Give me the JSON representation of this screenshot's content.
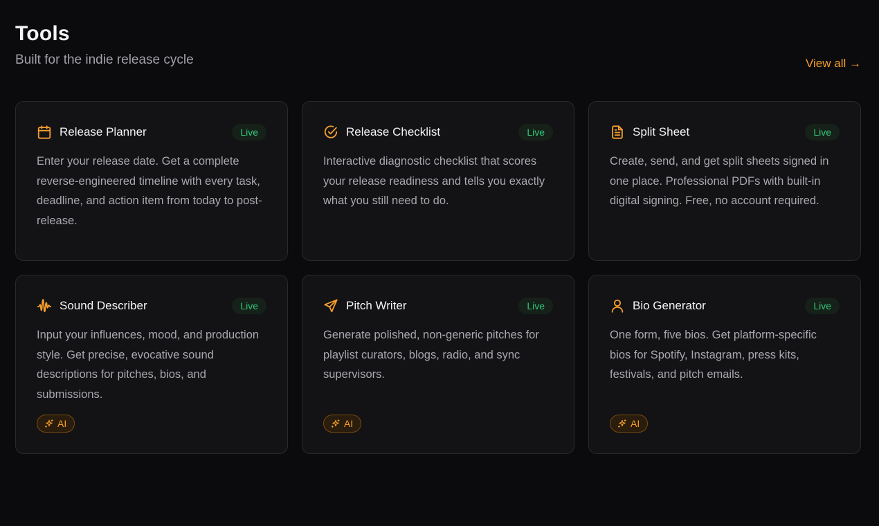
{
  "header": {
    "title": "Tools",
    "subtitle": "Built for the indie release cycle",
    "view_all": "View all →"
  },
  "colors": {
    "accent": "#f59e2c",
    "live": "#34c77b",
    "background": "#0b0b0d",
    "card": "#131315"
  },
  "cards": [
    {
      "title": "Release Planner",
      "icon": "calendar-icon",
      "status": "Live",
      "description": "Enter your release date. Get a complete reverse-engineered timeline with every task, deadline, and action item from today to post-release."
    },
    {
      "title": "Release Checklist",
      "icon": "check-circle-icon",
      "status": "Live",
      "description": "Interactive diagnostic checklist that scores your release readiness and tells you exactly what you still need to do."
    },
    {
      "title": "Split Sheet",
      "icon": "document-icon",
      "status": "Live",
      "description": "Create, send, and get split sheets signed in one place. Professional PDFs with built-in digital signing. Free, no account required."
    },
    {
      "title": "Sound Describer",
      "icon": "waveform-icon",
      "status": "Live",
      "description": "Input your influences, mood, and production style. Get precise, evocative sound descriptions for pitches, bios, and submissions.",
      "ai_label": "AI"
    },
    {
      "title": "Pitch Writer",
      "icon": "send-icon",
      "status": "Live",
      "description": "Generate polished, non-generic pitches for playlist curators, blogs, radio, and sync supervisors.",
      "ai_label": "AI"
    },
    {
      "title": "Bio Generator",
      "icon": "user-icon",
      "status": "Live",
      "description": "One form, five bios. Get platform-specific bios for Spotify, Instagram, press kits, festivals, and pitch emails.",
      "ai_label": "AI"
    }
  ]
}
